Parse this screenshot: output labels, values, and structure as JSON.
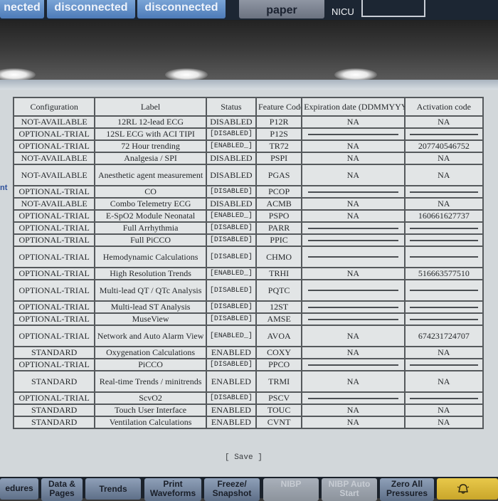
{
  "top_bar": {
    "buttons": [
      "nected",
      "disconnected",
      "disconnected",
      "paper"
    ],
    "info_line": "NICU"
  },
  "side_label": "nt",
  "table": {
    "headers": [
      "Configuration",
      "Label",
      "Status",
      "Feature Code",
      "Expiration date (DDMMYYYY)",
      "Activation code"
    ],
    "rows": [
      {
        "config": "NOT-AVAILABLE",
        "label": "12RL 12-lead ECG",
        "status": "DISABLED",
        "code": "P12R",
        "exp": "NA",
        "act": "NA"
      },
      {
        "config": "OPTIONAL-TRIAL",
        "label": "12SL ECG with ACI TIPI",
        "status": "[DISABLED]",
        "code": "P12S",
        "exp": "",
        "act": ""
      },
      {
        "config": "OPTIONAL-TRIAL",
        "label": "72 Hour trending",
        "status": "[ENABLED_]",
        "code": "TR72",
        "exp": "NA",
        "act": "207740546752"
      },
      {
        "config": "NOT-AVAILABLE",
        "label": "Analgesia / SPI",
        "status": "DISABLED",
        "code": "PSPI",
        "exp": "NA",
        "act": "NA"
      },
      {
        "config": "NOT-AVAILABLE",
        "label": "Anesthetic agent measurement",
        "status": "DISABLED",
        "code": "PGAS",
        "exp": "NA",
        "act": "NA"
      },
      {
        "config": "OPTIONAL-TRIAL",
        "label": "CO",
        "status": "[DISABLED]",
        "code": "PCOP",
        "exp": "",
        "act": ""
      },
      {
        "config": "NOT-AVAILABLE",
        "label": "Combo Telemetry ECG",
        "status": "DISABLED",
        "code": "ACMB",
        "exp": "NA",
        "act": "NA"
      },
      {
        "config": "OPTIONAL-TRIAL",
        "label": "E-SpO2 Module Neonatal",
        "status": "[ENABLED_]",
        "code": "PSPO",
        "exp": "NA",
        "act": "160661627737"
      },
      {
        "config": "OPTIONAL-TRIAL",
        "label": "Full Arrhythmia",
        "status": "[DISABLED]",
        "code": "PARR",
        "exp": "",
        "act": ""
      },
      {
        "config": "OPTIONAL-TRIAL",
        "label": "Full PiCCO",
        "status": "[DISABLED]",
        "code": "PPIC",
        "exp": "",
        "act": ""
      },
      {
        "config": "OPTIONAL-TRIAL",
        "label": "Hemodynamic Calculations",
        "status": "[DISABLED]",
        "code": "CHMO",
        "exp": "",
        "act": ""
      },
      {
        "config": "OPTIONAL-TRIAL",
        "label": "High Resolution Trends",
        "status": "[ENABLED_]",
        "code": "TRHI",
        "exp": "NA",
        "act": "516663577510"
      },
      {
        "config": "OPTIONAL-TRIAL",
        "label": "Multi-lead QT / QTc Analysis",
        "status": "[DISABLED]",
        "code": "PQTC",
        "exp": "",
        "act": ""
      },
      {
        "config": "OPTIONAL-TRIAL",
        "label": "Multi-lead ST Analysis",
        "status": "[DISABLED]",
        "code": "12ST",
        "exp": "",
        "act": ""
      },
      {
        "config": "OPTIONAL-TRIAL",
        "label": "MuseView",
        "status": "[DISABLED]",
        "code": "AMSE",
        "exp": "",
        "act": ""
      },
      {
        "config": "OPTIONAL-TRIAL",
        "label": "Network and Auto Alarm View",
        "status": "[ENABLED_]",
        "code": "AVOA",
        "exp": "NA",
        "act": "674231724707"
      },
      {
        "config": "STANDARD",
        "label": "Oxygenation Calculations",
        "status": "ENABLED",
        "code": "COXY",
        "exp": "NA",
        "act": "NA"
      },
      {
        "config": "OPTIONAL-TRIAL",
        "label": "PiCCO",
        "status": "[DISABLED]",
        "code": "PPCO",
        "exp": "",
        "act": ""
      },
      {
        "config": "STANDARD",
        "label": "Real-time Trends / minitrends",
        "status": "ENABLED",
        "code": "TRMI",
        "exp": "NA",
        "act": "NA"
      },
      {
        "config": "OPTIONAL-TRIAL",
        "label": "ScvO2",
        "status": "[DISABLED]",
        "code": "PSCV",
        "exp": "",
        "act": ""
      },
      {
        "config": "STANDARD",
        "label": "Touch User Interface",
        "status": "ENABLED",
        "code": "TOUC",
        "exp": "NA",
        "act": "NA"
      },
      {
        "config": "STANDARD",
        "label": "Ventilation Calculations",
        "status": "ENABLED",
        "code": "CVNT",
        "exp": "NA",
        "act": "NA"
      }
    ]
  },
  "save_button": "[ Save ]",
  "bottom_bar": {
    "buttons": [
      {
        "line1": "edures",
        "line2": ""
      },
      {
        "line1": "Data &",
        "line2": "Pages"
      },
      {
        "line1": "Trends",
        "line2": ""
      },
      {
        "line1": "Print",
        "line2": "Waveforms"
      },
      {
        "line1": "Freeze/",
        "line2": "Snapshot"
      },
      {
        "line1": "NIBP",
        "line2": ""
      },
      {
        "line1": "NIBP Auto",
        "line2": "Start"
      },
      {
        "line1": "Zero All",
        "line2": "Pressures"
      },
      {
        "line1": "",
        "line2": ""
      }
    ]
  },
  "colors": {
    "panel": "#d2d7da",
    "button_blue": "#5e86c2",
    "alarm_yellow": "#e0bf3c"
  }
}
